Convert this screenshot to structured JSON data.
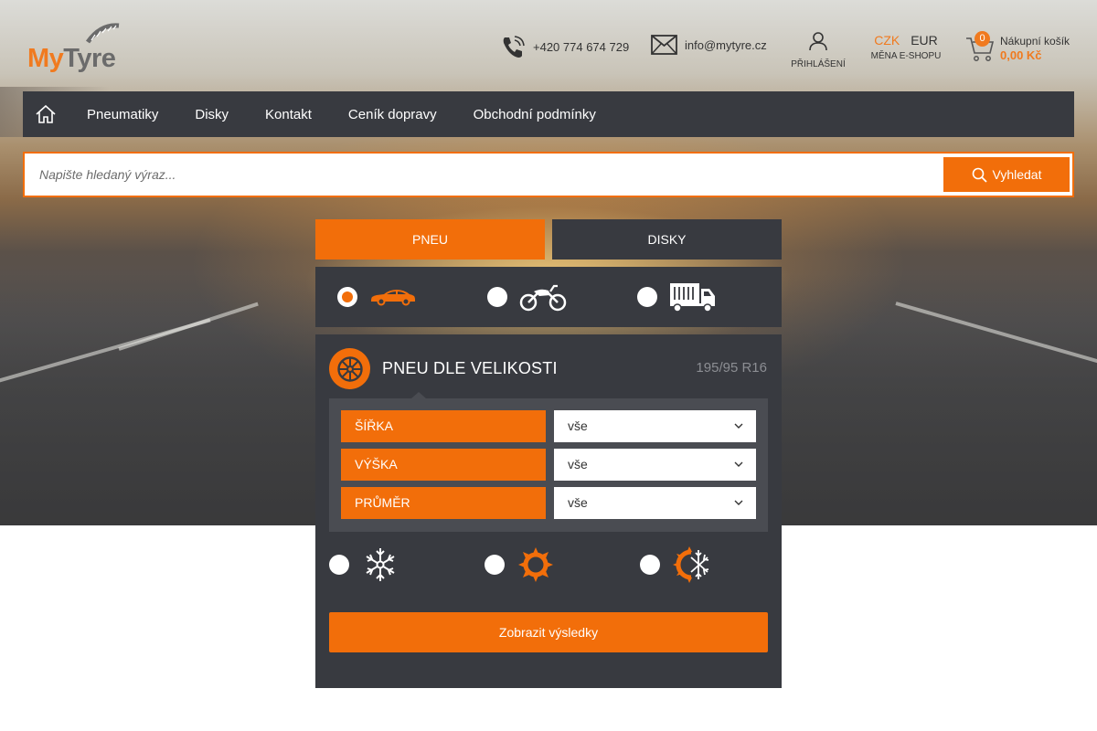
{
  "header": {
    "logo": {
      "my": "My",
      "tyre": "Tyre"
    },
    "phone": "+420 774 674 729",
    "email": "info@mytyre.cz",
    "account_label": "PŘIHLÁŠENÍ",
    "currency": {
      "options": [
        "CZK",
        "EUR"
      ],
      "selected": "CZK",
      "label": "MĚNA E-SHOPU"
    },
    "cart": {
      "count": "0",
      "title": "Nákupní košík",
      "total": "0,00 Kč"
    }
  },
  "nav": {
    "items": [
      "Pneumatiky",
      "Disky",
      "Kontakt",
      "Ceník dopravy",
      "Obchodní podmínky"
    ]
  },
  "search": {
    "placeholder": "Napište hledaný výraz...",
    "button_label": "Vyhledat"
  },
  "widget": {
    "tabs": [
      {
        "label": "PNEU",
        "active": true
      },
      {
        "label": "DISKY",
        "active": false
      }
    ],
    "vehicles": [
      {
        "name": "car-icon",
        "selected": true
      },
      {
        "name": "motorcycle-icon",
        "selected": false
      },
      {
        "name": "truck-icon",
        "selected": false
      }
    ],
    "panel_title": "PNEU DLE VELIKOSTI",
    "size_summary": "195/95 R16",
    "fields": [
      {
        "label": "ŠÍŘKA",
        "value": "vše"
      },
      {
        "label": "VÝŠKA",
        "value": "vše"
      },
      {
        "label": "PRŮMĚR",
        "value": "vše"
      }
    ],
    "seasons": [
      {
        "name": "winter-snowflake-icon",
        "selected": false
      },
      {
        "name": "summer-sun-icon",
        "selected": false
      },
      {
        "name": "all-season-icon",
        "selected": false
      }
    ],
    "submit_label": "Zobrazit výsledky"
  },
  "colors": {
    "accent": "#f26e0a",
    "dark": "#383a40",
    "field_bg": "#4a4c52",
    "muted": "#8c8e93"
  }
}
